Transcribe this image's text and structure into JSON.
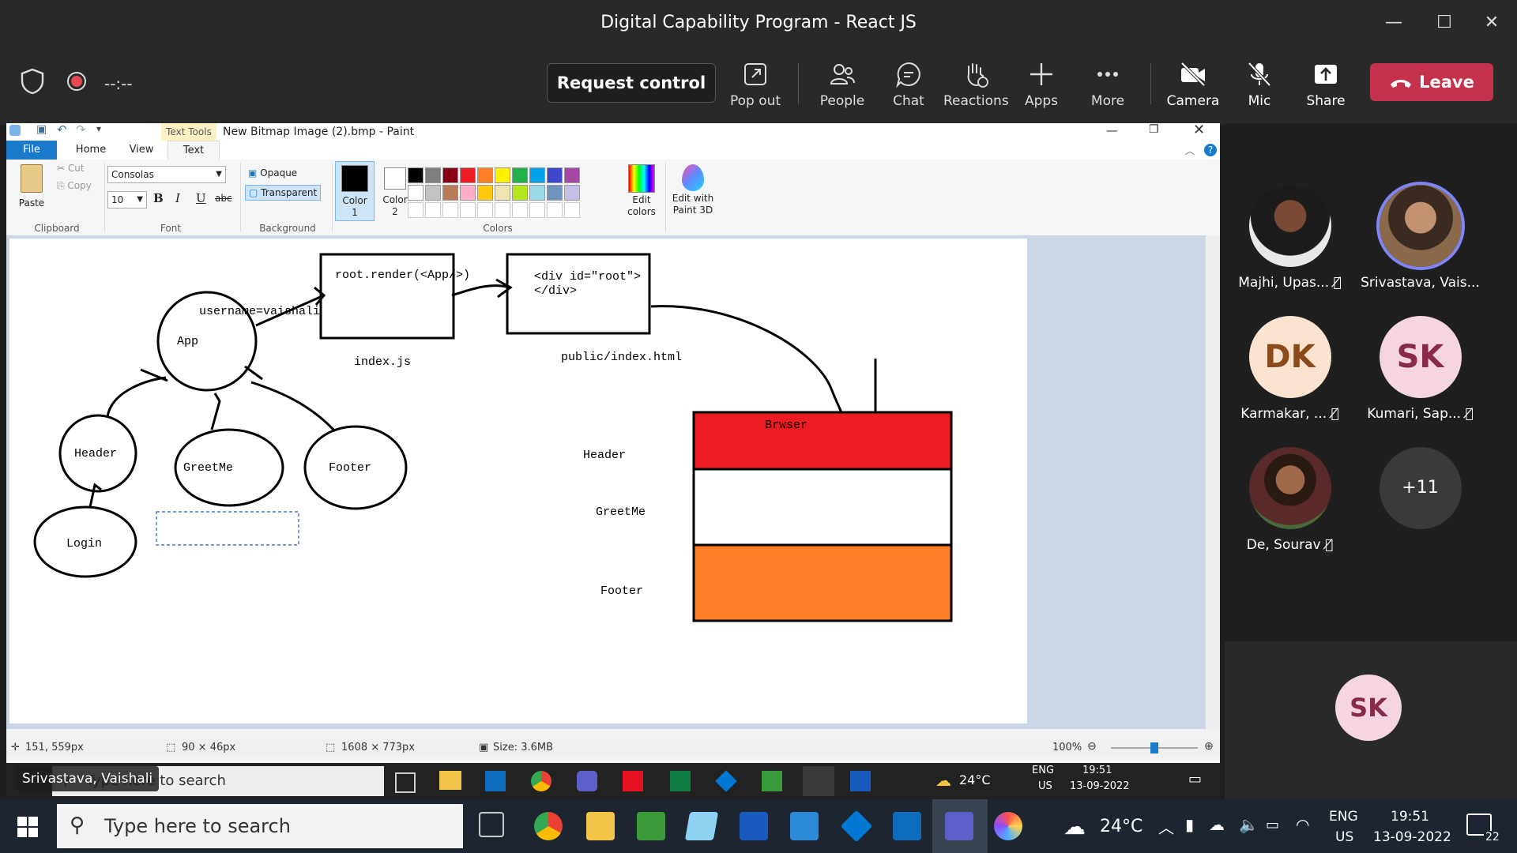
{
  "window": {
    "title": "Digital Capability Program - React JS",
    "minimize": "—",
    "maximize": "☐",
    "close": "✕"
  },
  "toolbar": {
    "timer": "--:--",
    "request_control": "Request control",
    "pop_out": "Pop out",
    "people": "People",
    "chat": "Chat",
    "reactions": "Reactions",
    "apps": "Apps",
    "more": "More",
    "camera": "Camera",
    "mic": "Mic",
    "share": "Share",
    "leave": "Leave",
    "leave_color": "#c4314b"
  },
  "paint": {
    "context_tab": "Text Tools",
    "doc_title": "New Bitmap Image (2).bmp - Paint",
    "tabs": [
      "File",
      "Home",
      "View",
      "Text"
    ],
    "clipboard": {
      "paste": "Paste",
      "cut": "Cut",
      "copy": "Copy",
      "label": "Clipboard"
    },
    "font": {
      "name": "Consolas",
      "size": "10",
      "label": "Font",
      "bold": "B",
      "italic": "I",
      "underline": "U",
      "strike": "abc"
    },
    "background": {
      "opaque": "Opaque",
      "transparent": "Transparent",
      "label": "Background"
    },
    "colors": {
      "color1": "Color 1",
      "color2": "Color 2",
      "label": "Colors",
      "edit": "Edit colors",
      "paint3d": "Edit with Paint 3D",
      "row1": [
        "#000000",
        "#7f7f7f",
        "#880015",
        "#ed1c24",
        "#ff7f27",
        "#fff200",
        "#22b14c",
        "#00a2e8",
        "#3f48cc",
        "#a349a4"
      ],
      "row2": [
        "#ffffff",
        "#c3c3c3",
        "#b97a57",
        "#ffaec9",
        "#ffc90e",
        "#efe4b0",
        "#b5e61d",
        "#99d9ea",
        "#7092be",
        "#c8bfe7"
      ]
    },
    "status": {
      "cursor": "151, 559px",
      "selection": "90 × 46px",
      "image": "1608 × 773px",
      "size": "Size: 3.6MB",
      "zoom": "100%"
    }
  },
  "diagram": {
    "app": "App",
    "username": "username=vaishali",
    "header": "Header",
    "greetme": "GreetMe",
    "footer": "Footer",
    "login": "Login",
    "render": "root.render(<App/>)",
    "index_js": "index.js",
    "div_root_1": "<div id=\"root\">",
    "div_root_2": "</div>",
    "index_html": "public/index.html",
    "browser": "Brwser",
    "b_header": "Header",
    "b_greetme": "GreetMe",
    "b_footer": "Footer",
    "header_color": "#ed1c24",
    "footer_color": "#ff7f27"
  },
  "presenter_label": "Srivastava, Vaishali",
  "share_taskbar": {
    "search": "Type here to search",
    "temp": "24°C",
    "lang1": "ENG",
    "lang2": "US",
    "time": "19:51",
    "date": "13-09-2022"
  },
  "participants": [
    {
      "name": "Majhi, Upas...",
      "initials": "",
      "muted": true
    },
    {
      "name": "Srivastava, Vais...",
      "initials": "",
      "muted": false
    },
    {
      "name": "Karmakar, ...",
      "initials": "DK",
      "muted": true
    },
    {
      "name": "Kumari, Sap...",
      "initials": "SK",
      "muted": true
    },
    {
      "name": "De, Sourav",
      "initials": "",
      "muted": true
    },
    {
      "name": "",
      "initials": "+11",
      "muted": false
    }
  ],
  "self_initials": "SK",
  "taskbar": {
    "search": "Type here to search",
    "temp": "24°C",
    "lang1": "ENG",
    "lang2": "US",
    "time": "19:51",
    "date": "13-09-2022",
    "notif": "22"
  }
}
